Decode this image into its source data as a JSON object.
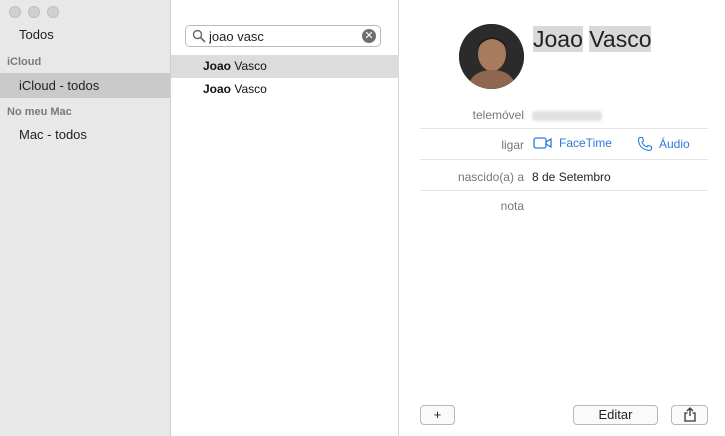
{
  "sidebar": {
    "groups": [
      {
        "header": "",
        "items": [
          {
            "label": "Todos"
          }
        ]
      },
      {
        "header": "iCloud",
        "items": [
          {
            "label": "iCloud - todos"
          }
        ]
      },
      {
        "header": "No meu Mac",
        "items": [
          {
            "label": "Mac - todos"
          }
        ]
      }
    ]
  },
  "search": {
    "value": "joao vasc",
    "placeholder": ""
  },
  "results": [
    {
      "first": "Joao",
      "last": "Vasco"
    },
    {
      "first": "Joao",
      "last": "Vasco"
    }
  ],
  "contact": {
    "first_name": "Joao",
    "last_name": "Vasco",
    "fields": {
      "mobile_label": "telemóvel",
      "call_label": "ligar",
      "facetime_label": "FaceTime",
      "audio_label": "Áudio",
      "birthday_label": "nascido(a) a",
      "birthday_value": "8 de Setembro",
      "note_label": "nota"
    }
  },
  "footer": {
    "add_label": "+",
    "edit_label": "Editar"
  },
  "colors": {
    "accent": "#2d7ad9",
    "sidebar_bg": "#e8e8e8",
    "selected_bg": "#cacaca"
  }
}
